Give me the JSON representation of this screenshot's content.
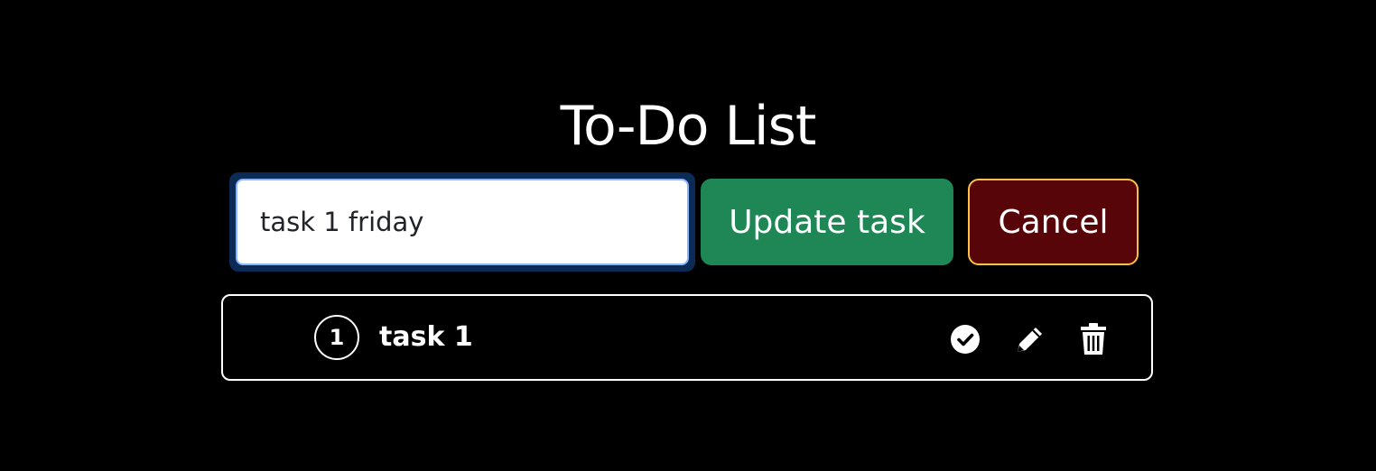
{
  "app": {
    "title": "To-Do List"
  },
  "form": {
    "input_value": "task 1 friday",
    "update_label": "Update task",
    "cancel_label": "Cancel"
  },
  "tasks": [
    {
      "number": "1",
      "text": "task 1",
      "actions": [
        "check-circle-icon",
        "pencil-icon",
        "trash-icon"
      ]
    }
  ],
  "colors": {
    "background": "#000000",
    "update_button": "#1f8755",
    "cancel_button": "#58050a",
    "cancel_border": "#ffc046",
    "input_focus_border": "#86b7fe",
    "input_focus_ring": "#0b2a55"
  }
}
